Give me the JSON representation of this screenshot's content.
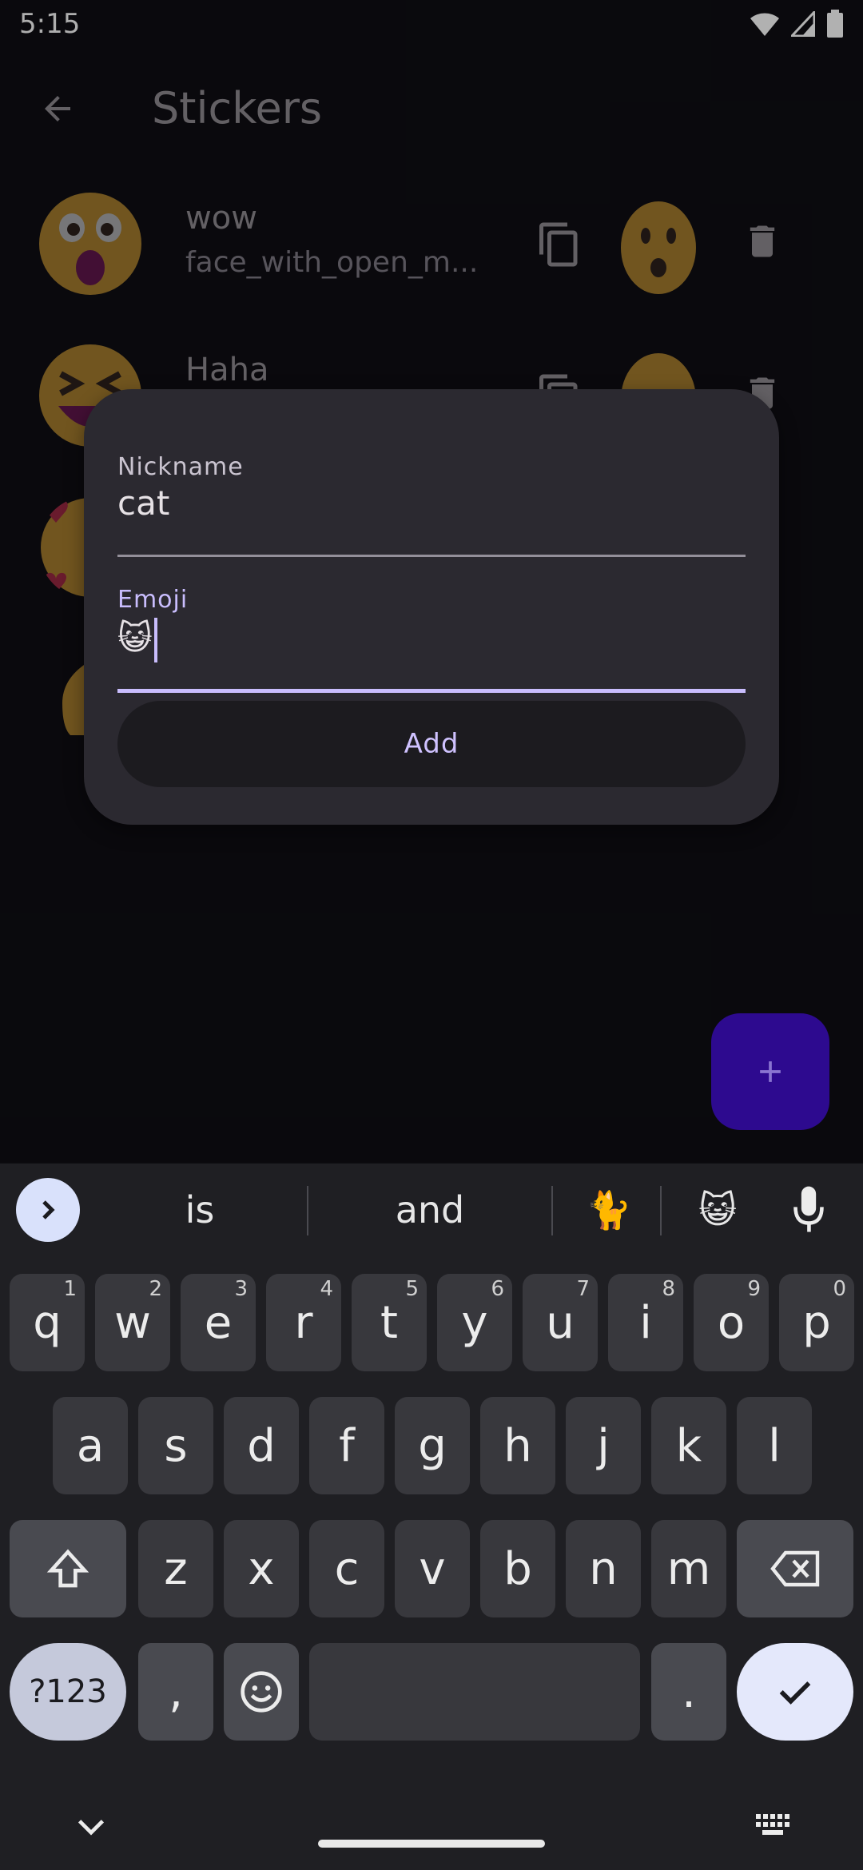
{
  "status": {
    "time": "5:15"
  },
  "app_bar": {
    "title": "Stickers"
  },
  "stickers": [
    {
      "name": "wow",
      "code": "face_with_open_m...",
      "emoji": "😮"
    },
    {
      "name": "Haha",
      "code": "",
      "emoji": "😆"
    }
  ],
  "dialog": {
    "nickname_label": "Nickname",
    "nickname_value": "cat",
    "emoji_label": "Emoji",
    "emoji_value": "😺",
    "add_label": "Add"
  },
  "keyboard": {
    "suggestions": [
      "is",
      "and",
      "🐈",
      "😺"
    ],
    "rows": [
      [
        {
          "k": "q",
          "h": "1"
        },
        {
          "k": "w",
          "h": "2"
        },
        {
          "k": "e",
          "h": "3"
        },
        {
          "k": "r",
          "h": "4"
        },
        {
          "k": "t",
          "h": "5"
        },
        {
          "k": "y",
          "h": "6"
        },
        {
          "k": "u",
          "h": "7"
        },
        {
          "k": "i",
          "h": "8"
        },
        {
          "k": "o",
          "h": "9"
        },
        {
          "k": "p",
          "h": "0"
        }
      ],
      [
        {
          "k": "a"
        },
        {
          "k": "s"
        },
        {
          "k": "d"
        },
        {
          "k": "f"
        },
        {
          "k": "g"
        },
        {
          "k": "h"
        },
        {
          "k": "j"
        },
        {
          "k": "k"
        },
        {
          "k": "l"
        }
      ],
      [
        {
          "k": "z"
        },
        {
          "k": "x"
        },
        {
          "k": "c"
        },
        {
          "k": "v"
        },
        {
          "k": "b"
        },
        {
          "k": "n"
        },
        {
          "k": "m"
        }
      ]
    ],
    "symbols_label": "?123",
    "comma": ",",
    "period": "."
  },
  "colors": {
    "accent": "#c9bdfd",
    "fab": "#2d0a8f",
    "dialog": "#2b2930"
  }
}
